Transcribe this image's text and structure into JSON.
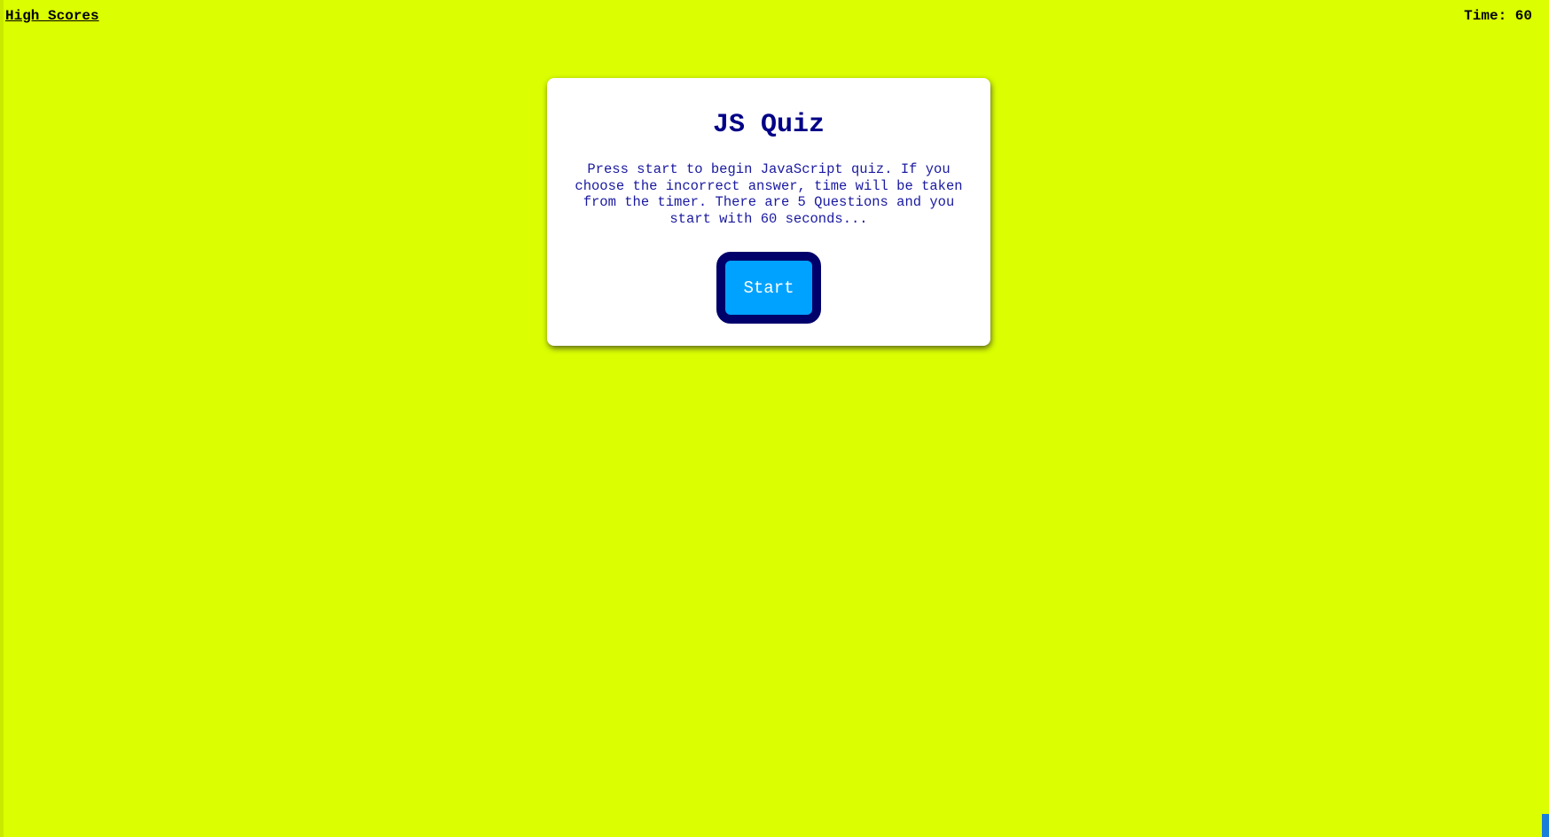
{
  "header": {
    "high_scores_label": "High Scores",
    "timer_label": "Time:",
    "timer_value": "60"
  },
  "quiz_card": {
    "title": "JS Quiz",
    "description": "Press start to begin JavaScript quiz. If you choose the incorrect answer, time will be taken from the timer. There are 5 Questions and you start with 60 seconds...",
    "start_label": "Start"
  },
  "colors": {
    "background": "#dbff00",
    "card": "#ffffff",
    "title_text": "#000087",
    "button_fill": "#00a2ff",
    "button_border": "#00006b"
  }
}
